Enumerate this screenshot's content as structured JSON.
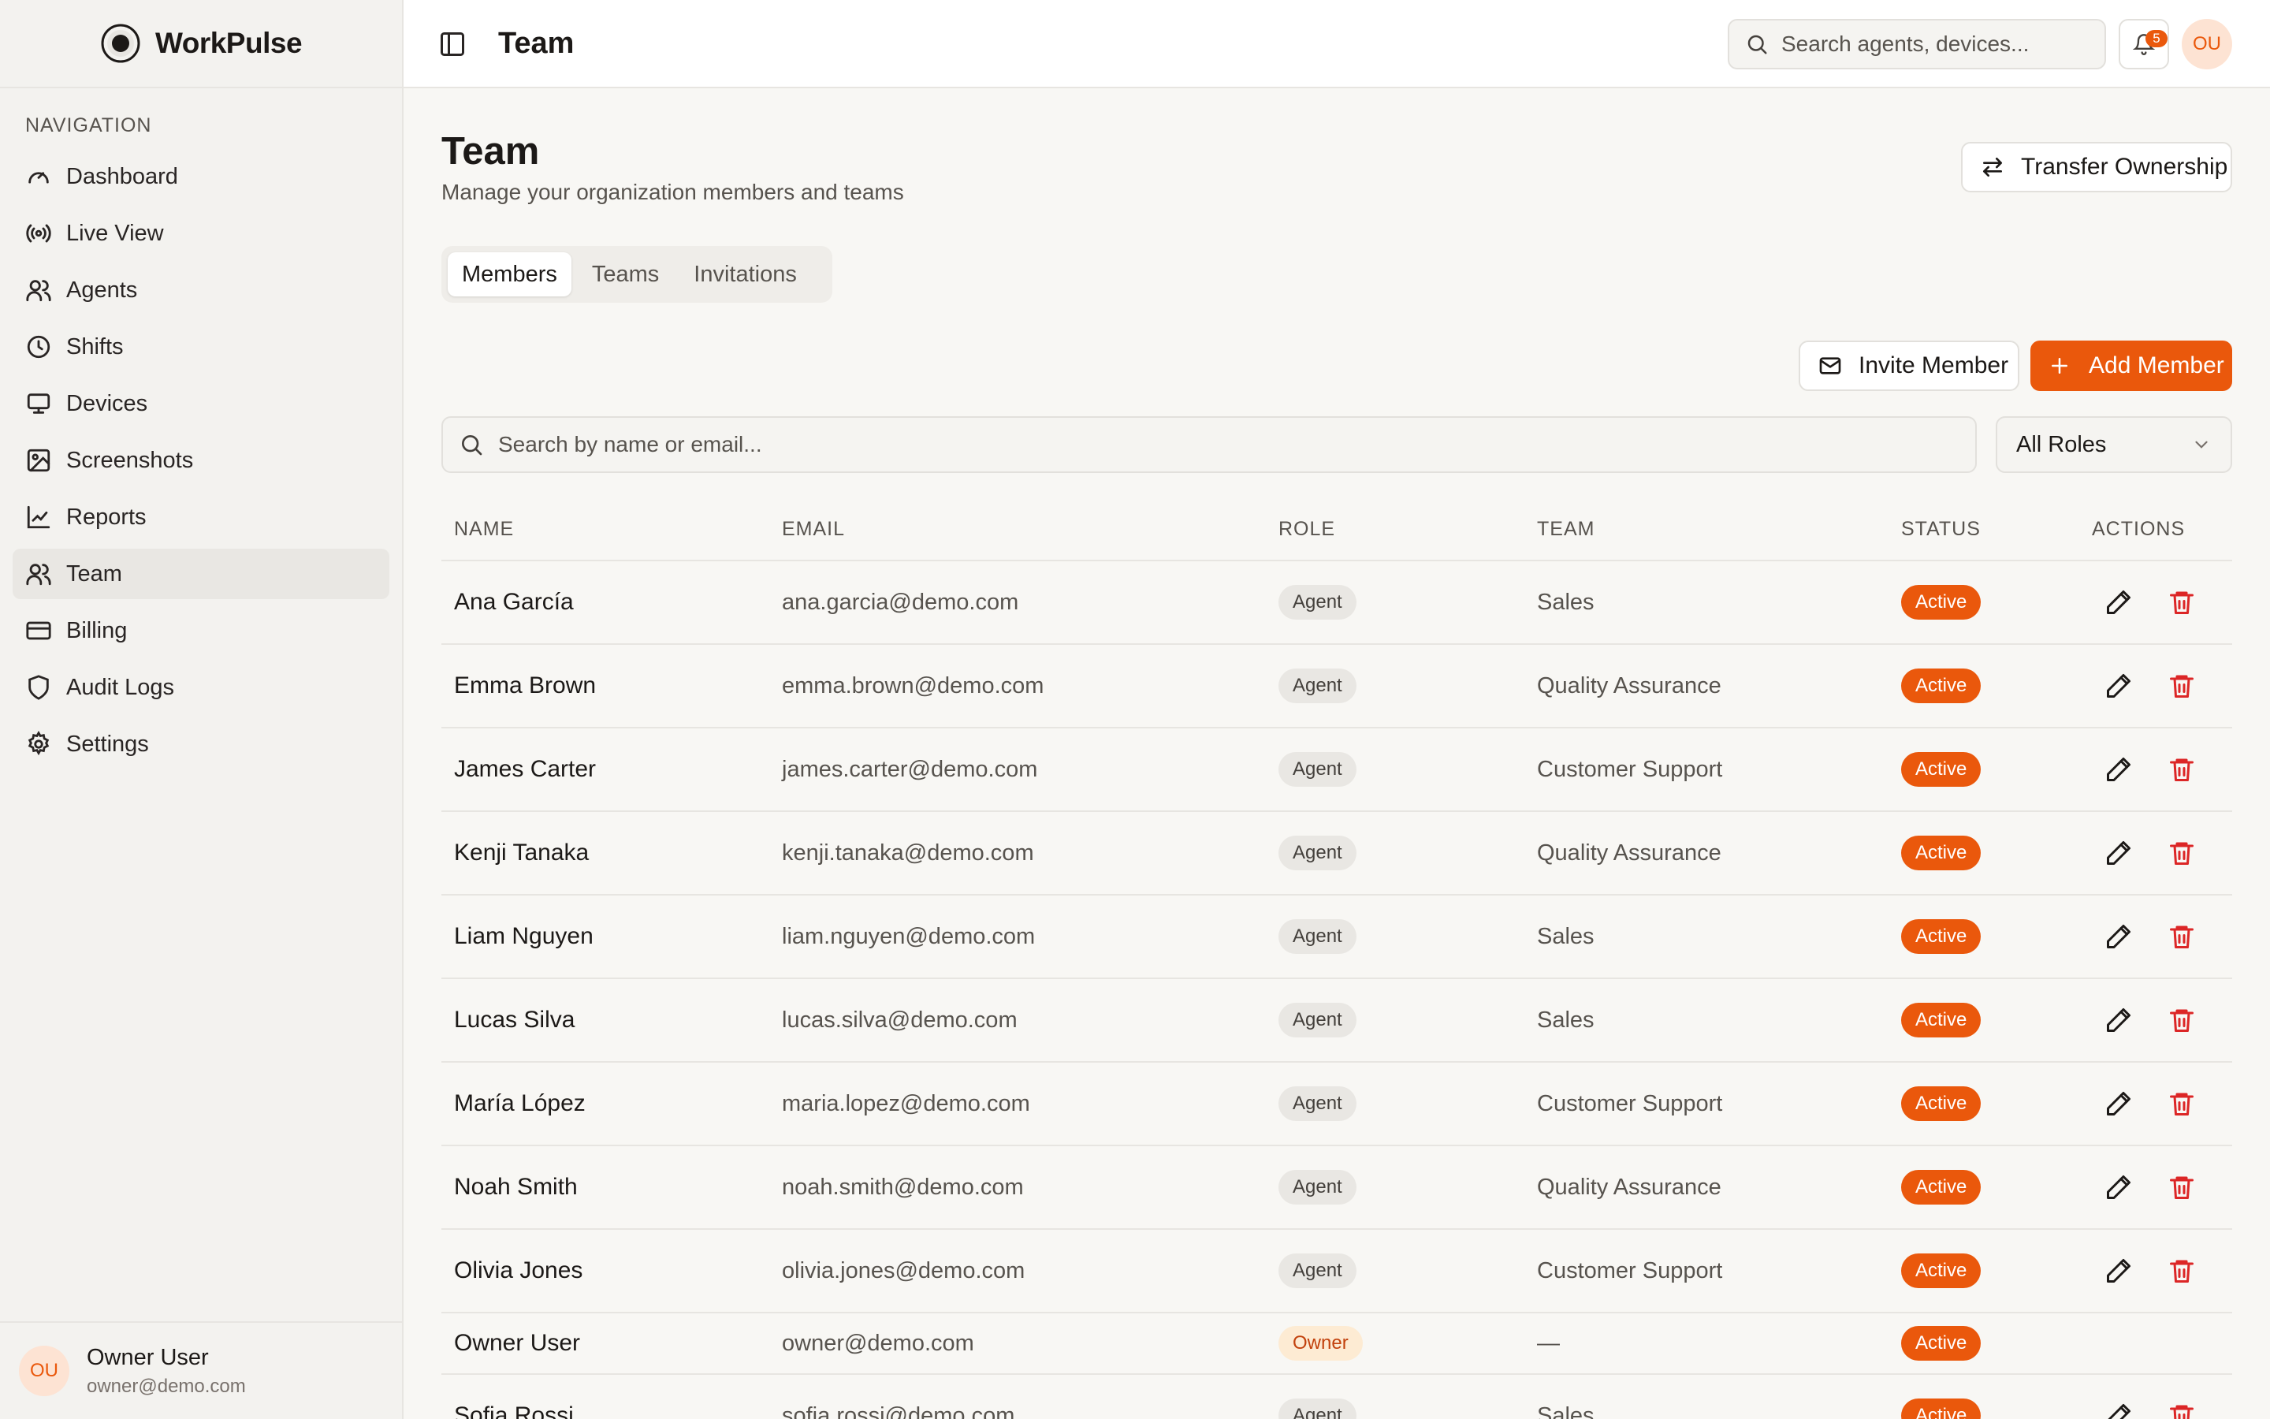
{
  "brand": {
    "name": "WorkPulse"
  },
  "sidebar": {
    "heading": "NAVIGATION",
    "items": [
      {
        "label": "Dashboard",
        "icon": "gauge-icon"
      },
      {
        "label": "Live View",
        "icon": "broadcast-icon"
      },
      {
        "label": "Agents",
        "icon": "users-icon"
      },
      {
        "label": "Shifts",
        "icon": "clock-icon"
      },
      {
        "label": "Devices",
        "icon": "monitor-icon"
      },
      {
        "label": "Screenshots",
        "icon": "image-icon"
      },
      {
        "label": "Reports",
        "icon": "chart-line-icon"
      },
      {
        "label": "Team",
        "icon": "users-icon",
        "active": true
      },
      {
        "label": "Billing",
        "icon": "credit-card-icon"
      },
      {
        "label": "Audit Logs",
        "icon": "shield-icon"
      },
      {
        "label": "Settings",
        "icon": "gear-icon"
      }
    ],
    "user": {
      "initials": "OU",
      "name": "Owner User",
      "email": "owner@demo.com"
    }
  },
  "topbar": {
    "title": "Team",
    "search_placeholder": "Search agents, devices...",
    "notification_count": "5",
    "avatar_initials": "OU"
  },
  "page": {
    "title": "Team",
    "subtitle": "Manage your organization members and teams",
    "transfer_label": "Transfer Ownership",
    "tabs": [
      "Members",
      "Teams",
      "Invitations"
    ],
    "active_tab": "Members",
    "invite_label": "Invite Member",
    "add_label": "Add Member",
    "search_placeholder": "Search by name or email...",
    "role_filter": "All Roles"
  },
  "table": {
    "columns": [
      "NAME",
      "EMAIL",
      "ROLE",
      "TEAM",
      "STATUS",
      "ACTIONS"
    ],
    "rows": [
      {
        "name": "Ana García",
        "email": "ana.garcia@demo.com",
        "role": "Agent",
        "team": "Sales",
        "status": "Active"
      },
      {
        "name": "Emma Brown",
        "email": "emma.brown@demo.com",
        "role": "Agent",
        "team": "Quality Assurance",
        "status": "Active"
      },
      {
        "name": "James Carter",
        "email": "james.carter@demo.com",
        "role": "Agent",
        "team": "Customer Support",
        "status": "Active"
      },
      {
        "name": "Kenji Tanaka",
        "email": "kenji.tanaka@demo.com",
        "role": "Agent",
        "team": "Quality Assurance",
        "status": "Active"
      },
      {
        "name": "Liam Nguyen",
        "email": "liam.nguyen@demo.com",
        "role": "Agent",
        "team": "Sales",
        "status": "Active"
      },
      {
        "name": "Lucas Silva",
        "email": "lucas.silva@demo.com",
        "role": "Agent",
        "team": "Sales",
        "status": "Active"
      },
      {
        "name": "María López",
        "email": "maria.lopez@demo.com",
        "role": "Agent",
        "team": "Customer Support",
        "status": "Active"
      },
      {
        "name": "Noah Smith",
        "email": "noah.smith@demo.com",
        "role": "Agent",
        "team": "Quality Assurance",
        "status": "Active"
      },
      {
        "name": "Olivia Jones",
        "email": "olivia.jones@demo.com",
        "role": "Agent",
        "team": "Customer Support",
        "status": "Active"
      },
      {
        "name": "Owner User",
        "email": "owner@demo.com",
        "role": "Owner",
        "team": "—",
        "status": "Active"
      },
      {
        "name": "Sofia Rossi",
        "email": "sofia.rossi@demo.com",
        "role": "Agent",
        "team": "Sales",
        "status": "Active"
      }
    ]
  },
  "colors": {
    "accent": "#ea580c",
    "danger": "#dc2626",
    "background": "#f8f7f4"
  }
}
